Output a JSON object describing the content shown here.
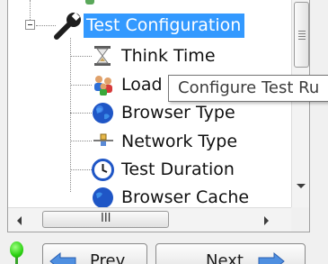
{
  "tree": {
    "root": {
      "label": "Test Configuration",
      "icon": "wrench-icon",
      "expanded": true
    },
    "children": [
      {
        "label": "Think Time",
        "icon": "hourglass-icon"
      },
      {
        "label": "Load",
        "icon": "users-icon"
      },
      {
        "label": "Browser Type",
        "icon": "globe-icon"
      },
      {
        "label": "Network Type",
        "icon": "network-icon"
      },
      {
        "label": "Test Duration",
        "icon": "clock-icon"
      },
      {
        "label": "Browser Cache",
        "icon": "globe-icon"
      }
    ]
  },
  "tooltip": {
    "text": "Configure Test Ru"
  },
  "scrollbar": {
    "h_grip": "III"
  },
  "buttons": {
    "prev": "Prev",
    "next": "Next"
  },
  "colors": {
    "selection": "#3399ff",
    "status_led": "#2bd112"
  }
}
